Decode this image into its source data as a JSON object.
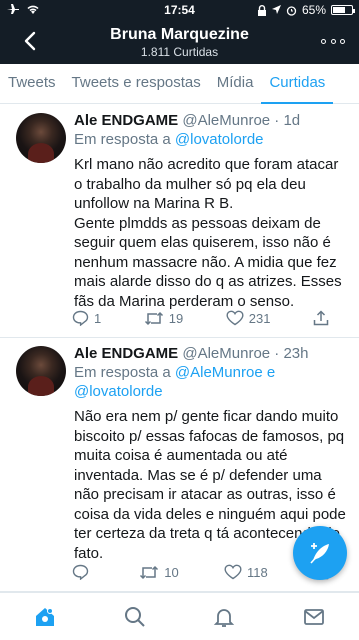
{
  "status_bar": {
    "time": "17:54",
    "battery": "65%"
  },
  "profile": {
    "name": "Bruna Marquezine",
    "subtitle": "1.811 Curtidas"
  },
  "tabs": [
    {
      "label": "Tweets"
    },
    {
      "label": "Tweets e respostas"
    },
    {
      "label": "Mídia"
    },
    {
      "label": "Curtidas"
    }
  ],
  "tweets": [
    {
      "name": "Ale ENDGAME",
      "handle": "@AleMunroe · 1d",
      "reply_prefix": "Em resposta a ",
      "reply_to": "@lovatolorde",
      "text": "Krl mano não acredito que foram atacar o trabalho da mulher só pq ela deu unfollow na Marina R B.\nGente plmdds as pessoas deixam de seguir quem elas quiserem, isso não é nenhum massacre não. A midia que fez mais alarde disso do q as atrizes. Esses fãs da Marina perderam o senso.",
      "replies": "1",
      "retweets": "19",
      "likes": "231"
    },
    {
      "name": "Ale ENDGAME",
      "handle": "@AleMunroe · 23h",
      "reply_prefix": "Em resposta a ",
      "reply_to": "@AleMunroe e @lovatolorde",
      "text": "Não era nem p/ gente ficar dando muito biscoito p/ essas fafocas de famosos, pq muita coisa é aumentada ou até inventada. Mas se é p/ defender uma não precisam ir atacar as outras, isso é coisa da vida deles e ninguém aqui pode ter certeza da treta q tá acontecendo de fato.",
      "replies": "",
      "retweets": "10",
      "likes": "118"
    }
  ],
  "colors": {
    "header_bg": "#141d26",
    "accent": "#1da1f2",
    "secondary_text": "#657786"
  }
}
